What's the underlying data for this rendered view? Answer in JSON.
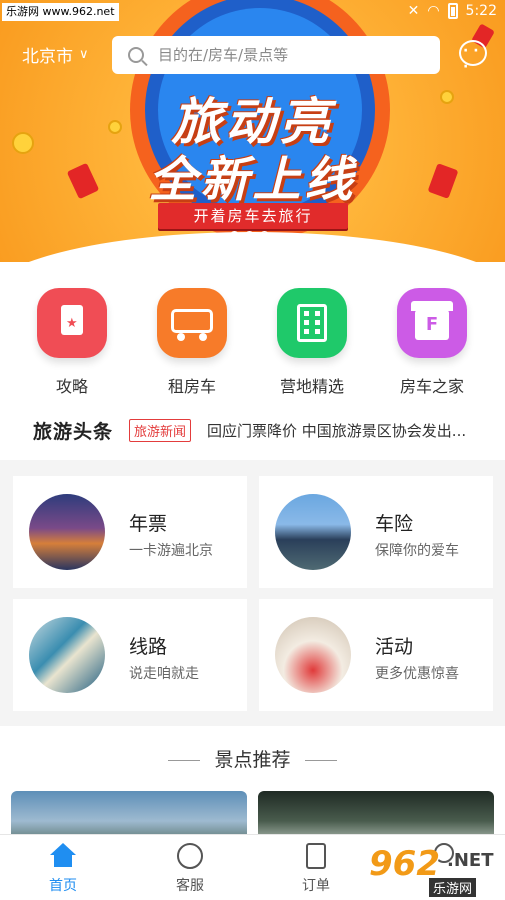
{
  "status_bar": {
    "site_tag": "乐游网 www.962.net",
    "time": "5:22"
  },
  "header": {
    "city": "北京市",
    "search_placeholder": "目的在/房车/景点等"
  },
  "banner": {
    "headline_line1": "旅动亮",
    "headline_line2": "全新上线",
    "ribbon": "开着房车去旅行",
    "page_count": 3,
    "active_page": 1
  },
  "quick_nav": [
    {
      "label": "攻略",
      "icon": "bookmark-star-icon"
    },
    {
      "label": "租房车",
      "icon": "rv-icon"
    },
    {
      "label": "营地精选",
      "icon": "building-icon"
    },
    {
      "label": "房车之家",
      "icon": "shop-icon"
    }
  ],
  "news": {
    "title": "旅游头条",
    "tag": "旅游新闻",
    "headline": "回应门票降价 中国旅游景区协会发出..."
  },
  "cards": [
    {
      "title": "年票",
      "subtitle": "一卡游遍北京"
    },
    {
      "title": "车险",
      "subtitle": "保障你的爱车"
    },
    {
      "title": "线路",
      "subtitle": "说走咱就走"
    },
    {
      "title": "活动",
      "subtitle": "更多优惠惊喜"
    }
  ],
  "recommend": {
    "title": "景点推荐"
  },
  "tabbar": [
    {
      "label": "首页",
      "icon": "home-icon",
      "active": true
    },
    {
      "label": "客服",
      "icon": "headset-icon",
      "active": false
    },
    {
      "label": "订单",
      "icon": "order-icon",
      "active": false
    }
  ],
  "watermark": {
    "number": "962",
    "net": ".NET",
    "site": "乐游网"
  },
  "colors": {
    "accent": "#1f8ef1",
    "banner_orange": "#f99b1f",
    "news_tag_red": "#e33c3c"
  }
}
